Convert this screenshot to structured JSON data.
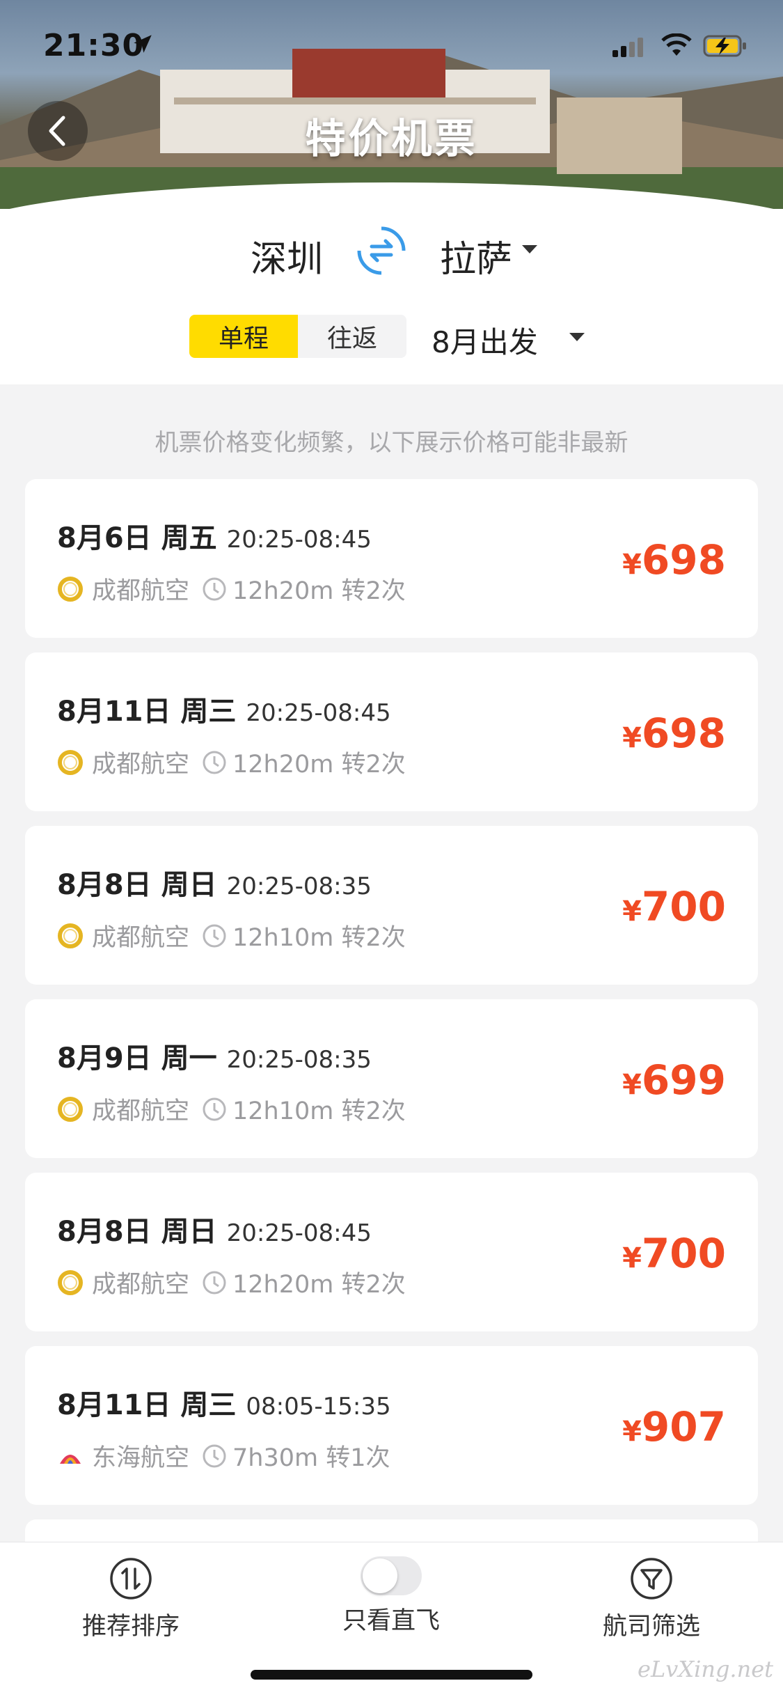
{
  "status_bar": {
    "time": "21:30"
  },
  "header": {
    "title": "特价机票"
  },
  "route": {
    "from": "深圳",
    "to": "拉萨",
    "trip_types": [
      "单程",
      "往返"
    ],
    "active_trip_type": "单程",
    "departure_month": "8月出发"
  },
  "notice": "机票价格变化频繁，以下展示价格可能非最新",
  "flights": [
    {
      "date": "8月6日 周五",
      "time": "20:25-08:45",
      "airline": "成都航空",
      "duration": "12h20m 转2次",
      "price": "698"
    },
    {
      "date": "8月11日 周三",
      "time": "20:25-08:45",
      "airline": "成都航空",
      "duration": "12h20m 转2次",
      "price": "698"
    },
    {
      "date": "8月8日 周日",
      "time": "20:25-08:35",
      "airline": "成都航空",
      "duration": "12h10m 转2次",
      "price": "700"
    },
    {
      "date": "8月9日 周一",
      "time": "20:25-08:35",
      "airline": "成都航空",
      "duration": "12h10m 转2次",
      "price": "699"
    },
    {
      "date": "8月8日 周日",
      "time": "20:25-08:45",
      "airline": "成都航空",
      "duration": "12h20m 转2次",
      "price": "700"
    },
    {
      "date": "8月11日 周三",
      "time": "08:05-15:35",
      "airline": "东海航空",
      "duration": "7h30m 转1次",
      "price": "907"
    }
  ],
  "currency_symbol": "¥",
  "bottom_bar": {
    "sort_label": "推荐排序",
    "direct_label": "只看直飞",
    "direct_only": false,
    "filter_label": "航司筛选"
  },
  "watermark": "eLvXing.net",
  "colors": {
    "accent_yellow": "#ffdc00",
    "price_red": "#f04a23",
    "swap_blue": "#3a9be8"
  }
}
